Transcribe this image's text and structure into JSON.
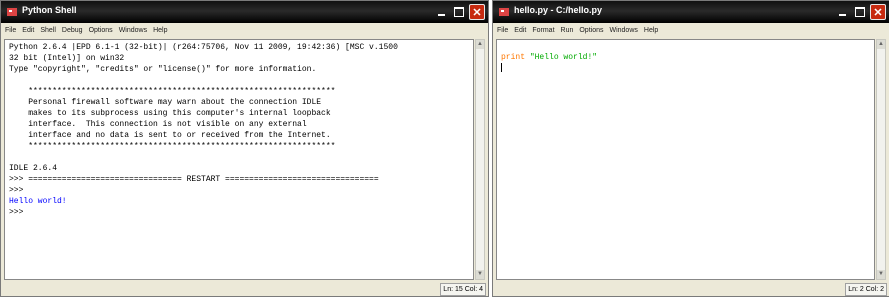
{
  "shell": {
    "title": "Python Shell",
    "menu": [
      "File",
      "Edit",
      "Shell",
      "Debug",
      "Options",
      "Windows",
      "Help"
    ],
    "lines": [
      {
        "text": "Python 2.6.4 |EPD 6.1-1 (32-bit)| (r264:75706, Nov 11 2009, 19:42:36) [MSC v.1500",
        "cls": ""
      },
      {
        "text": "32 bit (Intel)] on win32",
        "cls": ""
      },
      {
        "text": "Type \"copyright\", \"credits\" or \"license()\" for more information.",
        "cls": ""
      },
      {
        "text": "",
        "cls": ""
      },
      {
        "text": "    ****************************************************************",
        "cls": ""
      },
      {
        "text": "    Personal firewall software may warn about the connection IDLE",
        "cls": ""
      },
      {
        "text": "    makes to its subprocess using this computer's internal loopback",
        "cls": ""
      },
      {
        "text": "    interface.  This connection is not visible on any external",
        "cls": ""
      },
      {
        "text": "    interface and no data is sent to or received from the Internet.",
        "cls": ""
      },
      {
        "text": "    ****************************************************************",
        "cls": ""
      },
      {
        "text": "",
        "cls": ""
      },
      {
        "text": "IDLE 2.6.4",
        "cls": ""
      },
      {
        "text": ">>> ================================ RESTART ================================",
        "cls": ""
      },
      {
        "text": ">>>",
        "cls": ""
      },
      {
        "text": "Hello world!",
        "cls": "out-blue"
      },
      {
        "text": ">>>",
        "cls": ""
      }
    ],
    "status": "Ln: 15 Col: 4"
  },
  "editor": {
    "title": "hello.py - C:/hello.py",
    "menu": [
      "File",
      "Edit",
      "Format",
      "Run",
      "Options",
      "Windows",
      "Help"
    ],
    "code_keyword": "print",
    "code_string": "\"Hello world!\"",
    "status": "Ln: 2 Col: 2"
  }
}
